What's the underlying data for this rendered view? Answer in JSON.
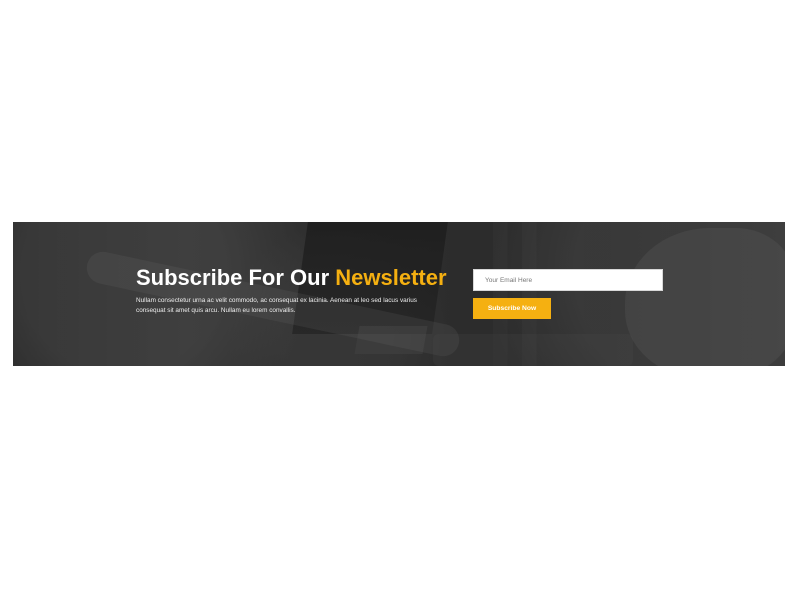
{
  "newsletter": {
    "title_prefix": "Subscribe For Our",
    "title_accent": "Newsletter",
    "description": "Nullam consectetur urna ac velit commodo, ac consequat ex lacinia. Aenean at leo sed lacus varius consequat sit amet quis arcu. Nullam eu lorem convallis.",
    "email_placeholder": "Your Email Here",
    "button_label": "Subscribe Now",
    "accent_color": "#f5b011",
    "background_color": "#343434"
  }
}
